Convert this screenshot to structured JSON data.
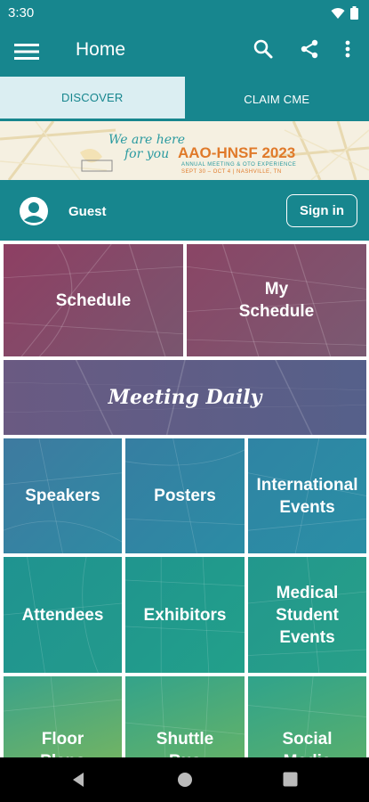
{
  "status": {
    "time": "3:30"
  },
  "appbar": {
    "title": "Home"
  },
  "tabs": [
    {
      "label": "DISCOVER"
    },
    {
      "label": "CLAIM CME"
    }
  ],
  "banner": {
    "tagline_line1": "We are here",
    "tagline_line2": "for you",
    "brand": "AAO-HNSF 2023",
    "sub_line1": "ANNUAL MEETING & OTO EXPERIENCE",
    "sub_line2": "SEPT 30 – OCT 4 | NASHVILLE, TN"
  },
  "user": {
    "name": "Guest",
    "signin_label": "Sign in"
  },
  "tiles": [
    {
      "label": "Schedule"
    },
    {
      "label": "My Schedule"
    },
    {
      "label": "Meeting Daily"
    },
    {
      "label": "Speakers"
    },
    {
      "label": "Posters"
    },
    {
      "label": "International Events"
    },
    {
      "label": "Attendees"
    },
    {
      "label": "Exhibitors"
    },
    {
      "label": "Medical Student Events"
    },
    {
      "label": "Floor Plans"
    },
    {
      "label": "Shuttle Bus"
    },
    {
      "label": "Social Media"
    }
  ],
  "colors": {
    "primary": "#17868e",
    "tab_active_bg": "#dbeef2",
    "banner_orange": "#e07a2a"
  },
  "icons": [
    "menu-icon",
    "search-icon",
    "share-icon",
    "more-vert-icon",
    "person-icon",
    "back-icon",
    "home-icon",
    "recent-apps-icon",
    "wifi-icon",
    "battery-icon"
  ]
}
